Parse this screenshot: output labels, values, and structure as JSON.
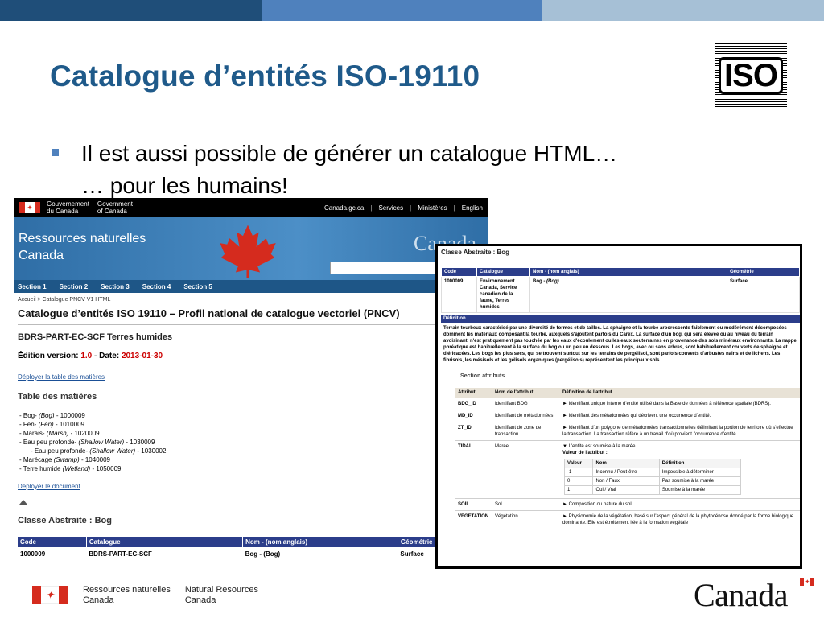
{
  "slide": {
    "title": "Catalogue d’entités ISO-19110",
    "iso_logo_text": "ISO",
    "bullet": {
      "line1": "Il est aussi possible de générer un catalogue HTML…",
      "line2": "… pour les humains!"
    },
    "colors": {
      "title": "#1f5a8a",
      "band_dark": "#1f4e79",
      "band_mid": "#4f81bd",
      "band_light": "#a6c0d6",
      "bullet": "#4f81bd"
    }
  },
  "page1": {
    "gc_name_en": "Government of Canada",
    "gc_name_fr": "Gouvernement du Canada",
    "gc_name_fr_l1": "Gouvernement",
    "gc_name_fr_l2": "du Canada",
    "gc_name_en_l1": "Government",
    "gc_name_en_l2": "of Canada",
    "top_links": [
      "Canada.gc.ca",
      "Services",
      "Ministères",
      "English"
    ],
    "banner_title_l1": "Ressources naturelles",
    "banner_title_l2": "Canada",
    "canada_wordmark": "Canada",
    "sections": [
      "Section 1",
      "Section 2",
      "Section 3",
      "Section 4",
      "Section 5"
    ],
    "breadcrumb": "Accueil > Catalogue PNCV V1 HTML",
    "catalogue_title": "Catalogue d’entités ISO 19110 – Profil national de catalogue vectoriel (PNCV)",
    "dataset": "BDRS-PART-EC-SCF Terres humides",
    "edition_label": "Édition version:",
    "edition_value": "1.0",
    "date_label": "- Date:",
    "date_value": "2013-01-30",
    "deploy_toc": "Déployer la table des matières",
    "toc_title": "Table des matières",
    "toc_items": [
      {
        "prefix": "- Bog-",
        "alias": "(Bog)",
        "code": "- 1000009",
        "indent": 0
      },
      {
        "prefix": "- Fen-",
        "alias": "(Fen)",
        "code": "- 1010009",
        "indent": 0
      },
      {
        "prefix": "- Marais-",
        "alias": "(Marsh)",
        "code": "- 1020009",
        "indent": 0
      },
      {
        "prefix": "- Eau peu profonde-",
        "alias": "(Shallow Water)",
        "code": "- 1030009",
        "indent": 0
      },
      {
        "prefix": "- Eau peu profonde-",
        "alias": "(Shallow Water)",
        "code": "- 1030002",
        "indent": 1
      },
      {
        "prefix": "- Marécage",
        "alias": "(Swamp)",
        "code": "- 1040009",
        "indent": 0
      },
      {
        "prefix": "- Terre humide",
        "alias": "(Wetland)",
        "code": "- 1050009",
        "indent": 0
      }
    ],
    "deploy_doc": "Déployer le document",
    "class_title": "Classe Abstraite : Bog",
    "table_headers": [
      "Code",
      "Catalogue",
      "Nom - (nom anglais)",
      "Géométrie"
    ],
    "table_row": [
      "1000009",
      "BDRS-PART-EC-SCF",
      "Bog - (Bog)",
      "Surface"
    ]
  },
  "page2": {
    "title": "Classe Abstraite : Bog",
    "headers": [
      "Code",
      "Catalogue",
      "Nom - (nom anglais)",
      "Géométrie"
    ],
    "row_code": "1000009",
    "row_catalogue": "Environnement Canada, Service canadien de la faune, Terres humides",
    "row_name": "Bog -",
    "row_name_alias": "(Bog)",
    "row_geom": "Surface",
    "definition_label": "Définition",
    "definition_text": "Terrain tourbeux caractérisé par une diversité de formes et de tailles. La sphaigne et la tourbe arborescente faiblement ou modérément décomposées dominent les matériaux composant la tourbe, auxquels s'ajoutent parfois du Carex. La surface d'un bog, qui sera élevée ou au niveau du terrain avoisinant, n'est pratiquement pas touchée par les eaux d'écoulement ou les eaux souterraines en provenance des sols minéraux environnants. La nappe phréatique est habituellement à la surface du bog ou un peu en dessous. Les bogs, avec ou sans arbres, sont habituellement couverts de sphaigne et d'éricacées. Les bogs les plus secs, qui se trouvent surtout sur les terrains de pergélisol, sont parfois couverts d'arbustes nains et de lichens. Les fibrisols, les mésisols et les gélisols organiques (pergélisols) représentent les principaux sols.",
    "section_attributes": "Section attributs",
    "attr_headers": [
      "Attribut",
      "Nom de l'attribut",
      "Définition de l'attribut"
    ],
    "attributes": [
      {
        "code": "BDG_ID",
        "name": "Identifiant BDG",
        "def": "► Identifiant unique interne d'entité utilisé dans la Base de données à référence spatiale (BDRS)."
      },
      {
        "code": "MD_ID",
        "name": "Identifiant de métadonnées",
        "def": "► Identifiant des métadonnées qui décrivent une occurrence d'entité."
      },
      {
        "code": "ZT_ID",
        "name": "Identifiant de zone de transaction",
        "def": "► Identifiant d'un polygone de métadonnées transactionnelles délimitant la portion de territoire où s'effectue la transaction. La transaction réfère à un travail d'où provient l'occurrence d'entité."
      },
      {
        "code": "TIDAL",
        "name": "Marée",
        "def": "▼ L'entité est soumise à la marée"
      },
      {
        "code": "SOIL",
        "name": "Sol",
        "def": "► Composition ou nature du sol"
      },
      {
        "code": "VEGETATION",
        "name": "Végétation",
        "def": "► Physionomie de la végétation, basé sur l'aspect général de la phytocénose donné par la forme biologique dominante. Elle est étroitement liée à la formation végétale"
      }
    ],
    "tidal_values_label": "Valeur de l'attribut :",
    "value_headers": [
      "Valeur",
      "Nom",
      "Définition"
    ],
    "values": [
      [
        "-1",
        "Inconnu / Peut-être",
        "Impossible à déterminer"
      ],
      [
        "0",
        "Non / Faux",
        "Pas soumise à la marée"
      ],
      [
        "1",
        "Oui / Vrai",
        "Soumise à la marée"
      ]
    ]
  },
  "footer": {
    "org_fr_l1": "Ressources naturelles",
    "org_fr_l2": "Canada",
    "org_en_l1": "Natural Resources",
    "org_en_l2": "Canada",
    "canada_logo": "Canada"
  }
}
